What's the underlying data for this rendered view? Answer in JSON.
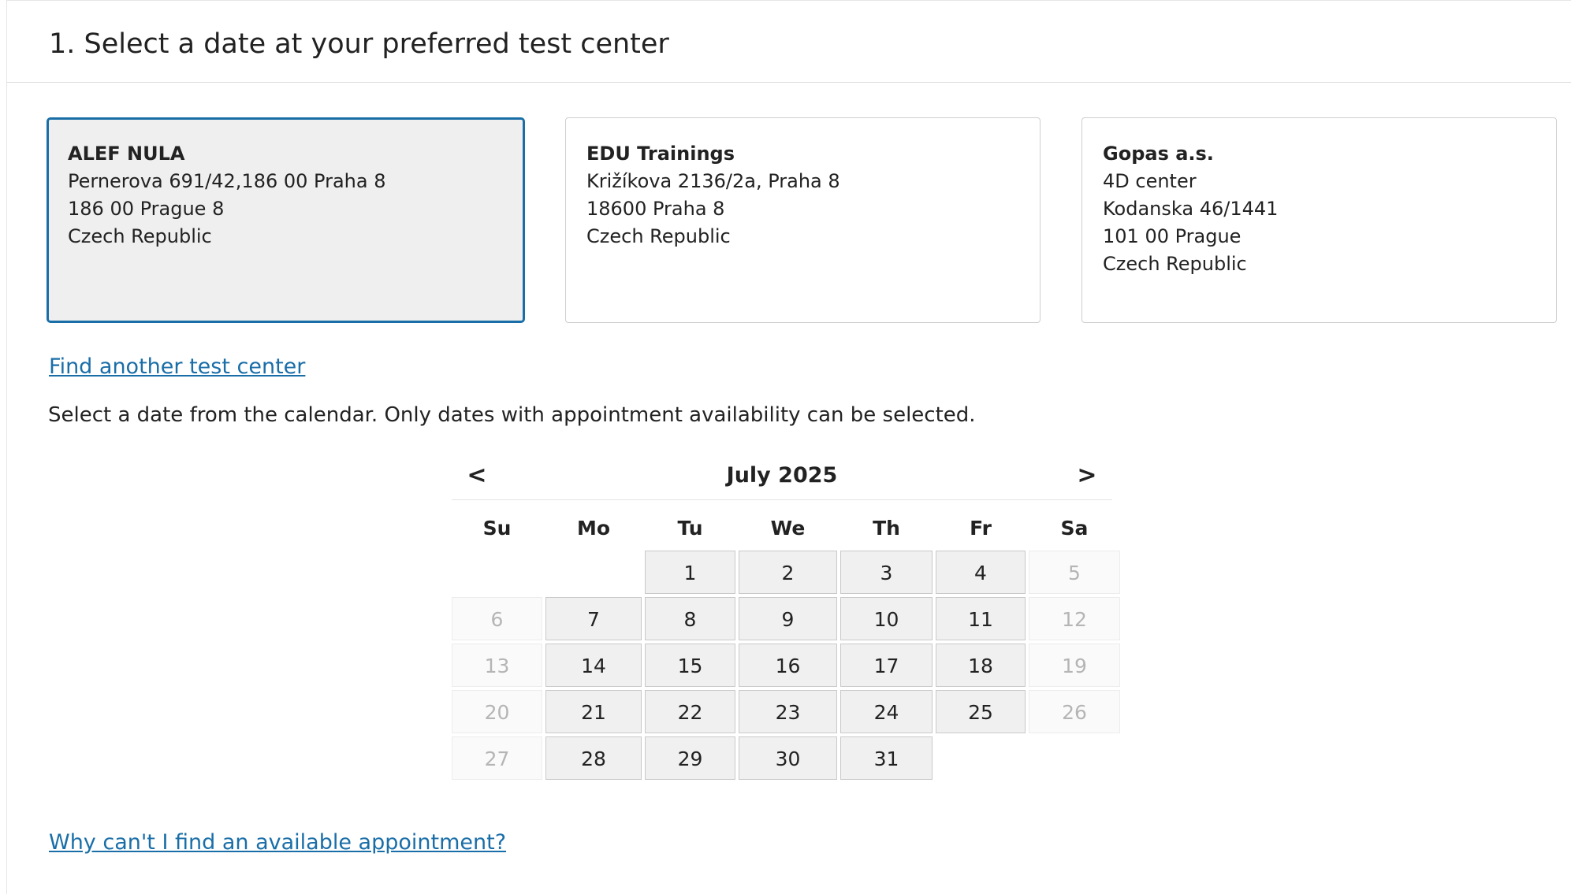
{
  "header": {
    "title": "1. Select a date at your preferred test center"
  },
  "test_centers": [
    {
      "name": "ALEF NULA",
      "lines": [
        "Pernerova 691/42,186 00 Praha 8",
        "186 00 Prague 8",
        "Czech Republic"
      ],
      "selected": true
    },
    {
      "name": "EDU Trainings",
      "lines": [
        "Križíkova 2136/2a, Praha 8",
        "18600 Praha 8",
        "Czech Republic"
      ],
      "selected": false
    },
    {
      "name": "Gopas a.s.",
      "lines": [
        "4D center",
        "Kodanska 46/1441",
        "101 00 Prague",
        "Czech Republic"
      ],
      "selected": false
    }
  ],
  "find_another_link": "Find another test center",
  "instruction": "Select a date from the calendar. Only dates with appointment availability can be selected.",
  "calendar": {
    "month_label": "July 2025",
    "prev_label": "<",
    "next_label": ">",
    "weekdays": [
      "Su",
      "Mo",
      "Tu",
      "We",
      "Th",
      "Fr",
      "Sa"
    ],
    "weeks": [
      [
        null,
        null,
        {
          "d": "1",
          "a": true
        },
        {
          "d": "2",
          "a": true
        },
        {
          "d": "3",
          "a": true
        },
        {
          "d": "4",
          "a": true
        },
        {
          "d": "5",
          "a": false
        }
      ],
      [
        {
          "d": "6",
          "a": false
        },
        {
          "d": "7",
          "a": true
        },
        {
          "d": "8",
          "a": true
        },
        {
          "d": "9",
          "a": true
        },
        {
          "d": "10",
          "a": true
        },
        {
          "d": "11",
          "a": true
        },
        {
          "d": "12",
          "a": false
        }
      ],
      [
        {
          "d": "13",
          "a": false
        },
        {
          "d": "14",
          "a": true
        },
        {
          "d": "15",
          "a": true
        },
        {
          "d": "16",
          "a": true
        },
        {
          "d": "17",
          "a": true
        },
        {
          "d": "18",
          "a": true
        },
        {
          "d": "19",
          "a": false
        }
      ],
      [
        {
          "d": "20",
          "a": false
        },
        {
          "d": "21",
          "a": true
        },
        {
          "d": "22",
          "a": true
        },
        {
          "d": "23",
          "a": true
        },
        {
          "d": "24",
          "a": true
        },
        {
          "d": "25",
          "a": true
        },
        {
          "d": "26",
          "a": false
        }
      ],
      [
        {
          "d": "27",
          "a": false
        },
        {
          "d": "28",
          "a": true
        },
        {
          "d": "29",
          "a": true
        },
        {
          "d": "30",
          "a": true
        },
        {
          "d": "31",
          "a": true
        },
        null,
        null
      ]
    ]
  },
  "help_link": "Why can't I find an available appointment?",
  "colors": {
    "accent": "#1a6ea8",
    "selected_bg": "#efefef",
    "available_bg": "#f0f0f0",
    "disabled_text": "#b5b5b5"
  }
}
